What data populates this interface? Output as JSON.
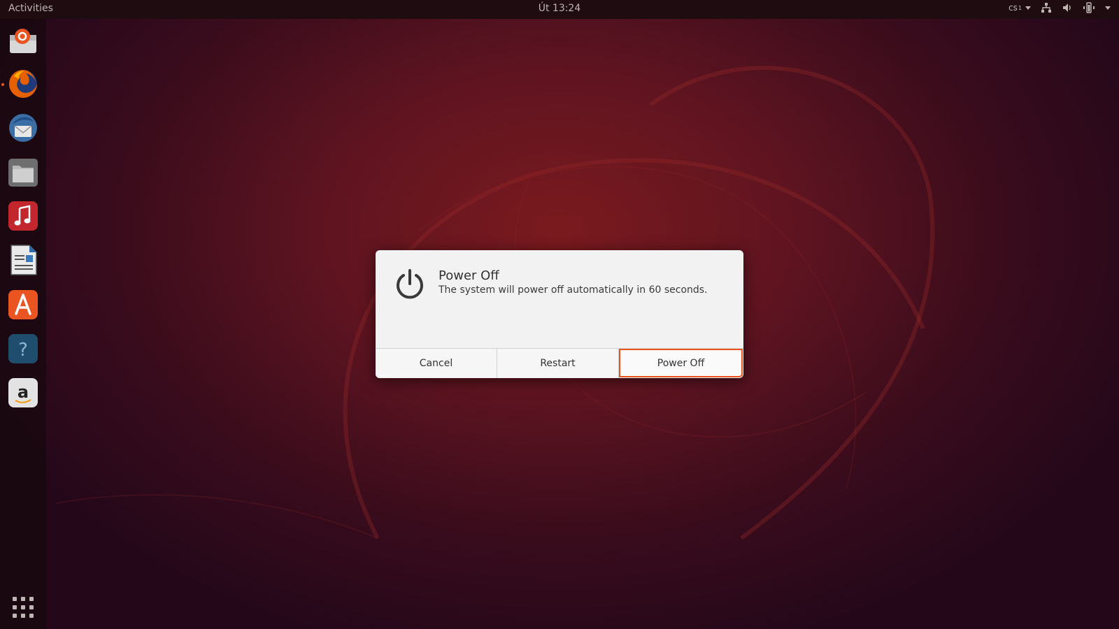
{
  "topbar": {
    "activities_label": "Activities",
    "clock": "Út 13:24",
    "keyboard_layout": "cs",
    "keyboard_layout_sub": "1",
    "tray_icons": [
      "network-icon",
      "volume-icon",
      "battery-icon",
      "system-menu-caret"
    ]
  },
  "dock": {
    "items": [
      {
        "name": "ubuntu-software-installer",
        "running": false
      },
      {
        "name": "firefox",
        "running": true
      },
      {
        "name": "thunderbird",
        "running": false
      },
      {
        "name": "files",
        "running": false
      },
      {
        "name": "rhythmbox",
        "running": false
      },
      {
        "name": "libreoffice-writer",
        "running": false
      },
      {
        "name": "ubuntu-software",
        "running": false
      },
      {
        "name": "help",
        "running": false
      },
      {
        "name": "amazon",
        "running": false
      }
    ],
    "show_apps_icon": "grid-icon"
  },
  "dialog": {
    "icon": "power-icon",
    "title": "Power Off",
    "message": "The system will power off automatically in 60 seconds.",
    "buttons": {
      "cancel": "Cancel",
      "restart": "Restart",
      "power_off": "Power Off"
    },
    "focused_button": "power_off"
  },
  "colors": {
    "accent": "#e95420",
    "topbar_bg": "#1e0c10",
    "dialog_bg": "#f2f2f2"
  }
}
